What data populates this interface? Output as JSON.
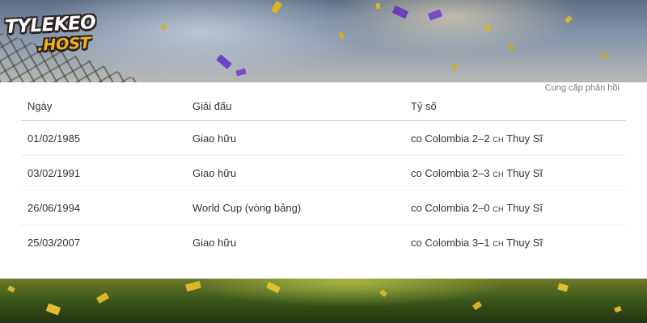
{
  "site": {
    "logo_line1": "TYLEKEO",
    "logo_line2": ".HOST"
  },
  "feedback": {
    "label": "Cung cấp phản hồi"
  },
  "table": {
    "headers": {
      "date": "Ngày",
      "competition": "Giải đấu",
      "score": "Tỷ số"
    },
    "rows": [
      {
        "date": "01/02/1985",
        "competition": "Giao hữu",
        "home_code": "co",
        "home_team": "Colombia",
        "score": "2–2",
        "away_code": "CH",
        "away_team": "Thuy Sĩ"
      },
      {
        "date": "03/02/1991",
        "competition": "Giao hữu",
        "home_code": "co",
        "home_team": "Colombia",
        "score": "2–3",
        "away_code": "CH",
        "away_team": "Thuy Sĩ"
      },
      {
        "date": "26/06/1994",
        "competition": "World Cup (vòng bảng)",
        "home_code": "co",
        "home_team": "Colombia",
        "score": "2–0",
        "away_code": "CH",
        "away_team": "Thuy Sĩ"
      },
      {
        "date": "25/03/2007",
        "competition": "Giao hữu",
        "home_code": "co",
        "home_team": "Colombia",
        "score": "3–1",
        "away_code": "CH",
        "away_team": "Thuy Sĩ"
      }
    ]
  },
  "colors": {
    "logo_primary": "#ffffff",
    "logo_accent": "#f2b01e",
    "text": "#333333",
    "muted": "#7a7a7a",
    "header_rule": "#c9c9c9"
  }
}
